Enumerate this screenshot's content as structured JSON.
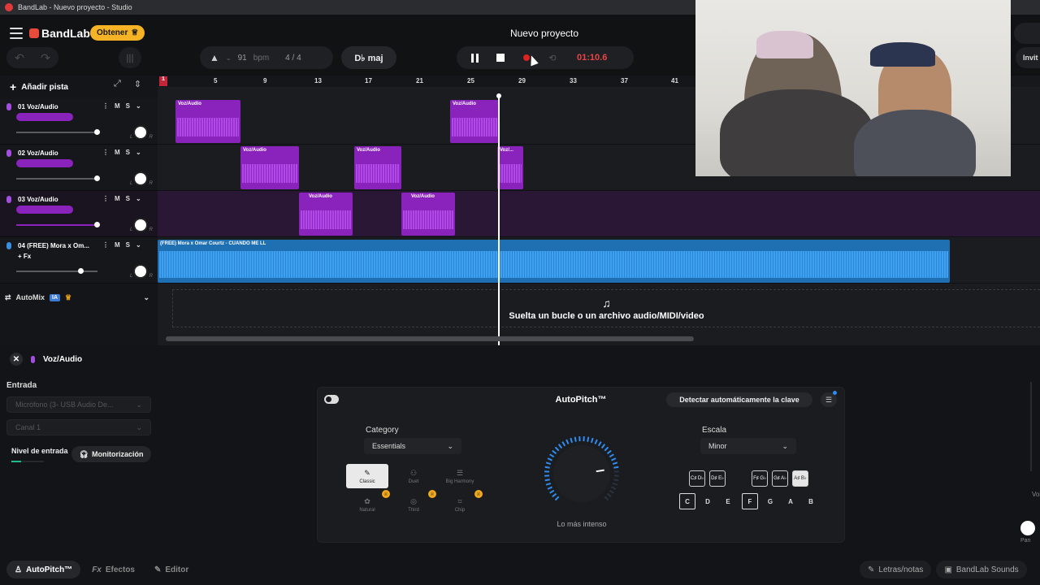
{
  "window_title": "BandLab - Nuevo proyecto - Studio",
  "brand": "BandLab",
  "obtener": "Obtener",
  "project_title": "Nuevo proyecto",
  "tempo": {
    "bpm_value": "91",
    "bpm_label": "bpm",
    "time_sig": "4 / 4"
  },
  "key": "D♭ maj",
  "time_display": "01:10.6",
  "invite_label": "Invit",
  "add_track": "Añadir pista",
  "ruler_ticks": [
    "1",
    "5",
    "9",
    "13",
    "17",
    "21",
    "25",
    "29",
    "33",
    "37",
    "41"
  ],
  "tracks": [
    {
      "num_name": "01  Voz/Audio",
      "color": "#a34ee0",
      "fx": ""
    },
    {
      "num_name": "02  Voz/Audio",
      "color": "#a34ee0",
      "fx": ""
    },
    {
      "num_name": "03  Voz/Audio",
      "color": "#a34ee0",
      "fx": ""
    },
    {
      "num_name": "04  (FREE) Mora x Om...",
      "color": "#3a8ee0",
      "fx": "+ Fx"
    }
  ],
  "mute_label": "M",
  "solo_label": "S",
  "clips": {
    "voz": "Voz/Audio",
    "voz_short": "Voz/...",
    "beat": "(FREE) Mora x Omar Courtz - CUANDO ME LL"
  },
  "automix": {
    "label": "AutoMix",
    "ia": "IA"
  },
  "dropzone_text": "Suelta un bucle o un archivo audio/MIDI/video",
  "panel": {
    "track_name": "Voz/Audio",
    "entrada": "Entrada",
    "input_device": "Micrófono (3- USB Audio De...",
    "channel": "Canal 1",
    "nivel": "Nivel de entrada",
    "monitor": "Monitorización"
  },
  "autopitch": {
    "title": "AutoPitch™",
    "detect": "Detectar automáticamente la clave",
    "category_label": "Category",
    "category_value": "Essentials",
    "presets": [
      "Classic",
      "Duet",
      "Big Harmony",
      "Natural",
      "Third",
      "Chip"
    ],
    "knob_label": "Lo más intenso",
    "knob_level": 0.8,
    "scale_label": "Escala",
    "scale_value": "Minor",
    "sharps": [
      "C♯ D♭",
      "D♯ E♭",
      "F♯ G♭",
      "G♯ A♭",
      "A♯ B♭"
    ],
    "naturals": [
      "C",
      "D",
      "E",
      "F",
      "G",
      "A",
      "B"
    ]
  },
  "bottom_tabs": {
    "autopitch": "AutoPitch™",
    "efectos": "Efectos",
    "editor": "Editor",
    "letras": "Letras/notas",
    "sounds": "BandLab Sounds"
  },
  "pan_label": "Pan",
  "vol_label": "Vol",
  "colors": {
    "accent_red": "#e84545",
    "purple": "#8a22bc",
    "blue": "#1f6fb3",
    "obtener": "#f5b325"
  }
}
